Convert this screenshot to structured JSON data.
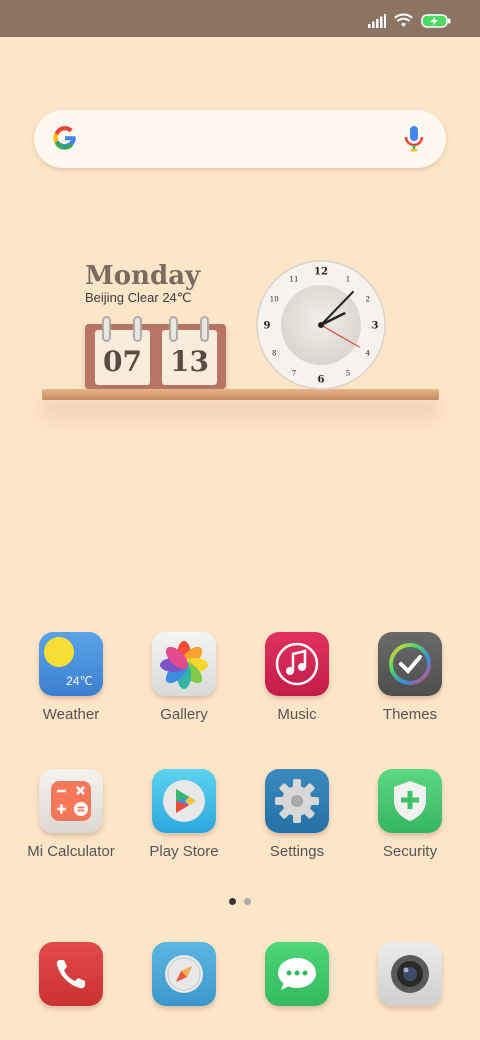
{
  "status_bar": {
    "icons": [
      "signal-icon",
      "wifi-icon",
      "battery-charging-icon"
    ],
    "background": "#8b7461"
  },
  "search": {
    "icons": [
      "google-logo-icon",
      "microphone-icon"
    ]
  },
  "widget": {
    "day": "Monday",
    "weather": "Beijing Clear 24℃",
    "month": "07",
    "date": "13",
    "clock": {
      "numerals": [
        "12",
        "1",
        "2",
        "3",
        "4",
        "5",
        "6",
        "7",
        "8",
        "9",
        "10",
        "11"
      ],
      "hour": 2,
      "minute": 7,
      "second": 20
    }
  },
  "apps": [
    {
      "label": "Weather",
      "icon": "weather-icon",
      "badge": "24℃"
    },
    {
      "label": "Gallery",
      "icon": "gallery-icon"
    },
    {
      "label": "Music",
      "icon": "music-icon"
    },
    {
      "label": "Themes",
      "icon": "themes-icon"
    },
    {
      "label": "Mi Calculator",
      "icon": "calculator-icon"
    },
    {
      "label": "Play Store",
      "icon": "play-store-icon"
    },
    {
      "label": "Settings",
      "icon": "settings-icon"
    },
    {
      "label": "Security",
      "icon": "security-icon"
    }
  ],
  "page_indicator": {
    "pages": 2,
    "active": 0
  },
  "dock": [
    {
      "icon": "phone-icon"
    },
    {
      "icon": "browser-icon"
    },
    {
      "icon": "messaging-icon"
    },
    {
      "icon": "camera-icon"
    }
  ],
  "colors": {
    "background": "#fde5c8",
    "label_text": "#555555"
  }
}
